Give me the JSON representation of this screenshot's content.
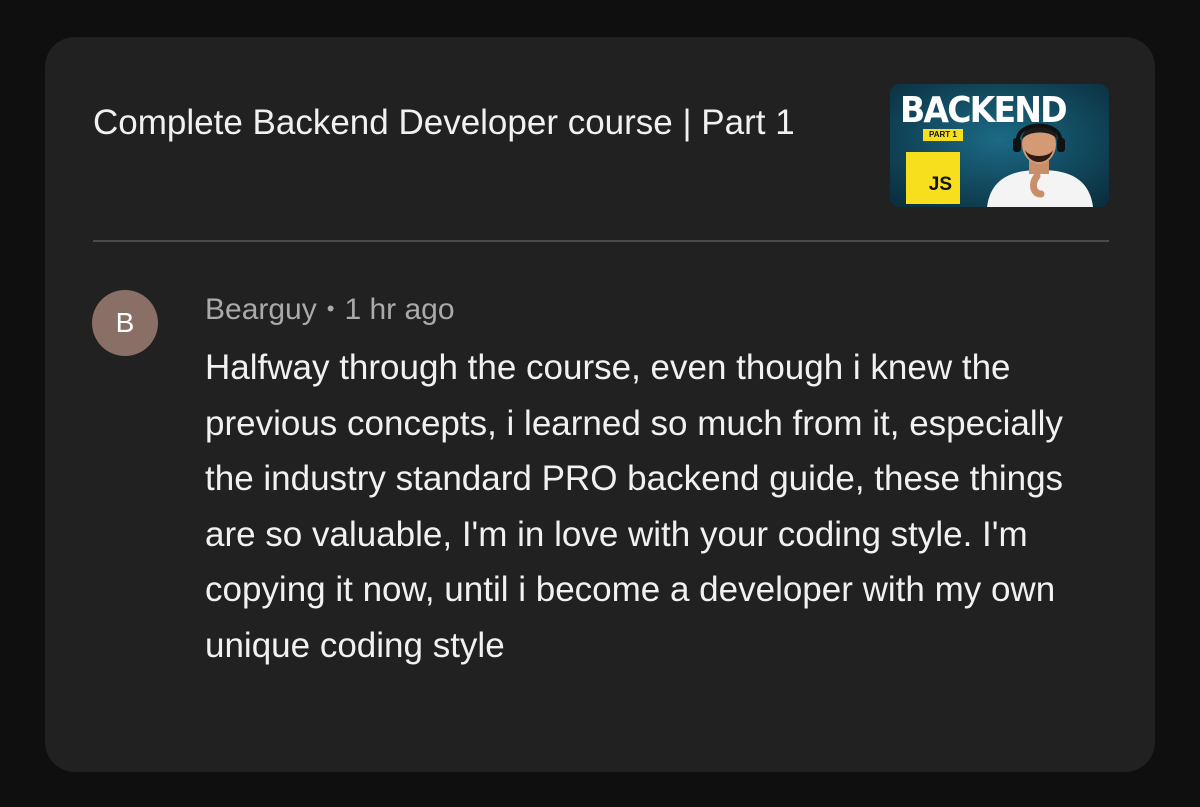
{
  "video": {
    "title": "Complete Backend Developer course | Part 1",
    "thumbnail": {
      "title_text": "BACKEND",
      "part_text": "PART 1",
      "badge_text": "JS",
      "accent_color": "#f7df1e",
      "background_color": "#0d3a4c"
    }
  },
  "comment": {
    "avatar_letter": "B",
    "avatar_color": "#8a6f66",
    "author": "Bearguy",
    "separator": "•",
    "timestamp": "1 hr ago",
    "text": "Halfway through the course, even though i knew the previous concepts, i learned so much from it, especially the industry standard PRO backend guide, these things are so valuable, I'm in love with your coding style. I'm copying it now, until i become a developer with my own unique coding style"
  },
  "colors": {
    "page_background": "#0f0f0f",
    "card_background": "#212121",
    "primary_text": "#f1f1f1",
    "secondary_text": "#aaaaaa"
  }
}
